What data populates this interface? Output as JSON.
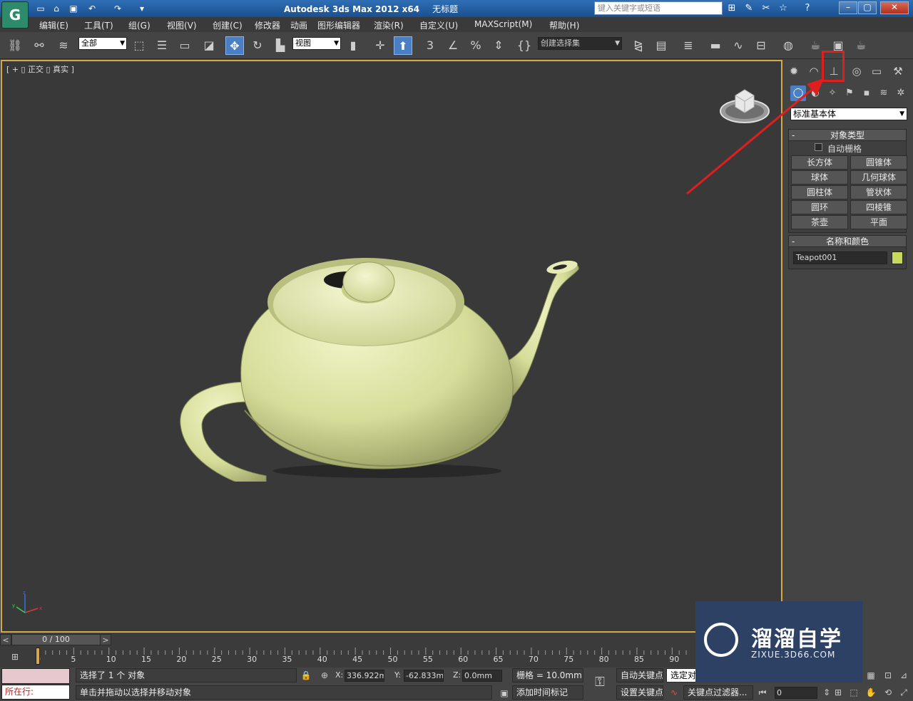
{
  "titlebar": {
    "app_title": "Autodesk 3ds Max  2012 x64",
    "doc_title": "无标题",
    "search_placeholder": "键入关键字或短语"
  },
  "menu": {
    "items": [
      "编辑(E)",
      "工具(T)",
      "组(G)",
      "视图(V)",
      "创建(C)",
      "修改器",
      "动画",
      "图形编辑器",
      "渲染(R)",
      "自定义(U)",
      "MAXScript(M)",
      "帮助(H)"
    ]
  },
  "toolbar": {
    "selection_filter": "全部",
    "ref_coord": "视图",
    "named_selection": "创建选择集",
    "snap_label": "3"
  },
  "viewport": {
    "label": "[ + ▯ 正交 ▯ 真实 ]",
    "object_color": "#d6dd99"
  },
  "command_panel": {
    "category": "标准基本体",
    "object_type_title": "对象类型",
    "autogrid_label": "自动栅格",
    "buttons": [
      "长方体",
      "圆锥体",
      "球体",
      "几何球体",
      "圆柱体",
      "管状体",
      "圆环",
      "四棱锥",
      "茶壶",
      "平面"
    ],
    "name_color_title": "名称和颜色",
    "object_name": "Teapot001",
    "object_color": "#c8d85a"
  },
  "timeline": {
    "frame": "0 / 100",
    "ticks": [
      "0",
      "5",
      "10",
      "15",
      "20",
      "25",
      "30",
      "35",
      "40",
      "45",
      "50",
      "55",
      "60",
      "65",
      "70",
      "75",
      "80",
      "85",
      "90"
    ]
  },
  "status": {
    "running_label": "所在行:",
    "selection_text": "选择了 1 个 对象",
    "prompt_text": "单击并拖动以选择并移动对象",
    "x_label": "X:",
    "x_value": "336.922mm",
    "y_label": "Y:",
    "y_value": "-62.833mm",
    "z_label": "Z:",
    "z_value": "0.0mm",
    "grid_text": "栅格 = 10.0mm",
    "add_time_tag": "添加时间标记",
    "auto_key": "自动关键点",
    "set_key": "设置关键点",
    "selected_dropdown": "选定对",
    "key_filter": "关键点过滤器...",
    "frame_value": "0"
  },
  "watermark": {
    "title": "溜溜自学",
    "subtitle": "ZIXUE.3D66.COM"
  }
}
